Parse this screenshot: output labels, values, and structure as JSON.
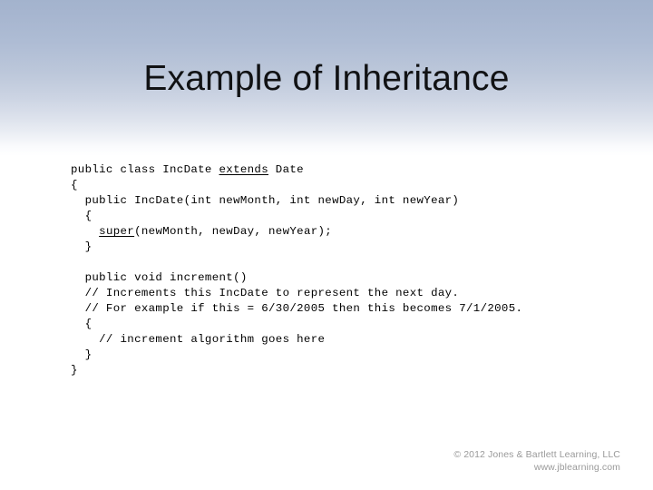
{
  "slide": {
    "title": "Example of Inheritance",
    "background_top_color": "#a3b3cd",
    "background_bottom_color": "#ffffff",
    "title_color": "#111214"
  },
  "code": {
    "language": "java",
    "lines": [
      {
        "id": "l1",
        "pre": "public class IncDate ",
        "keyword": "extends",
        "post": " Date"
      },
      {
        "id": "l2",
        "pre": "{",
        "keyword": "",
        "post": ""
      },
      {
        "id": "l3",
        "pre": "  public IncDate(int newMonth, int newDay, int newYear)",
        "keyword": "",
        "post": ""
      },
      {
        "id": "l4",
        "pre": "  {",
        "keyword": "",
        "post": ""
      },
      {
        "id": "l5",
        "pre": "    ",
        "keyword": "super",
        "post": "(newMonth, newDay, newYear);"
      },
      {
        "id": "l6",
        "pre": "  }",
        "keyword": "",
        "post": ""
      },
      {
        "id": "l7",
        "pre": "",
        "keyword": "",
        "post": ""
      },
      {
        "id": "l8",
        "pre": "  public void increment()",
        "keyword": "",
        "post": ""
      },
      {
        "id": "l9",
        "pre": "  // Increments this IncDate to represent the next day.",
        "keyword": "",
        "post": ""
      },
      {
        "id": "l10",
        "pre": "  // For example if this = 6/30/2005 then this becomes 7/1/2005.",
        "keyword": "",
        "post": ""
      },
      {
        "id": "l11",
        "pre": "  {",
        "keyword": "",
        "post": ""
      },
      {
        "id": "l12",
        "pre": "    // increment algorithm goes here",
        "keyword": "",
        "post": ""
      },
      {
        "id": "l13",
        "pre": "  }",
        "keyword": "",
        "post": ""
      },
      {
        "id": "l14",
        "pre": "}",
        "keyword": "",
        "post": ""
      }
    ]
  },
  "footer": {
    "copyright": "© 2012 Jones & Bartlett Learning, LLC",
    "website": "www.jblearning.com",
    "color": "#9a9a9a"
  }
}
